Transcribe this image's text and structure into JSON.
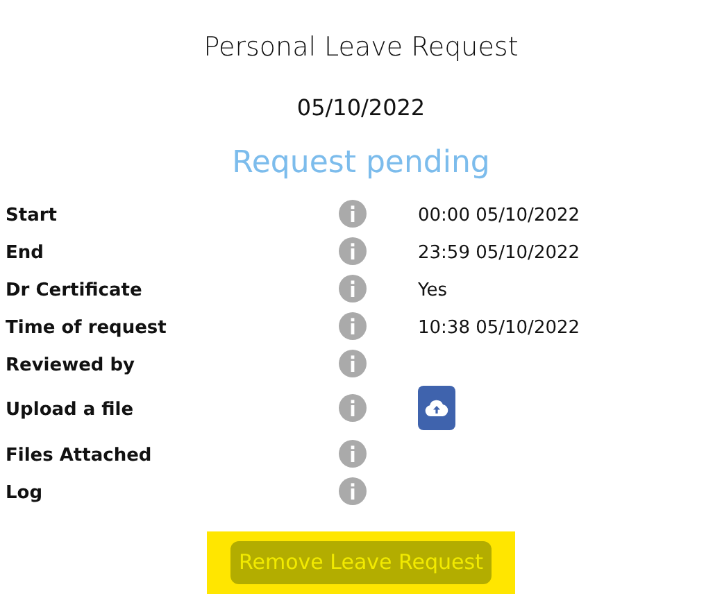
{
  "title": "Personal Leave Request",
  "date": "05/10/2022",
  "status": "Request pending",
  "fields": [
    {
      "label": "Start",
      "kind": "text",
      "value": "00:00 05/10/2022"
    },
    {
      "label": "End",
      "kind": "text",
      "value": "23:59 05/10/2022"
    },
    {
      "label": "Dr Certificate",
      "kind": "text",
      "value": "Yes"
    },
    {
      "label": "Time of request",
      "kind": "text",
      "value": "10:38 05/10/2022"
    },
    {
      "label": "Reviewed by",
      "kind": "empty"
    },
    {
      "label": "Upload a file",
      "kind": "upload"
    },
    {
      "label": "Files Attached",
      "kind": "empty"
    },
    {
      "label": "Log",
      "kind": "empty"
    }
  ],
  "action_button": "Remove Leave Request"
}
